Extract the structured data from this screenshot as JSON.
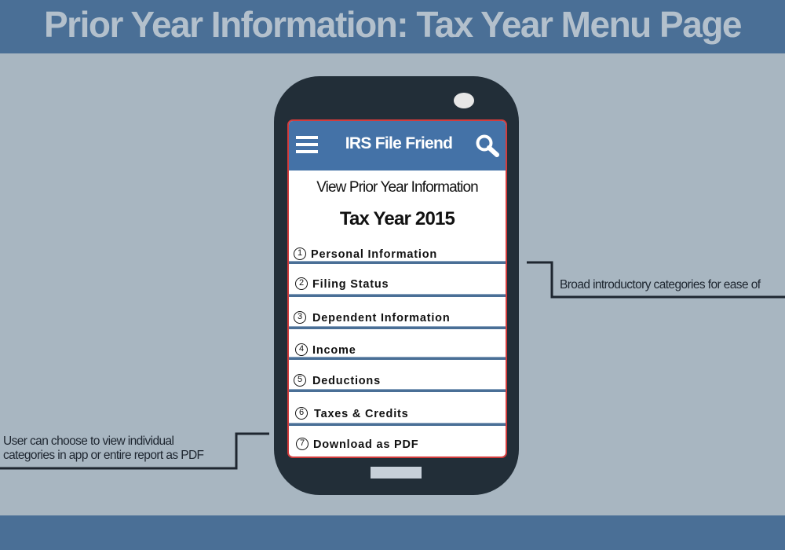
{
  "slide": {
    "title": "Prior Year Information: Tax Year Menu Page"
  },
  "app": {
    "title": "IRS File Friend",
    "subtitle": "View Prior Year Information",
    "tax_year_label": "Tax Year 2015",
    "menu_items": [
      {
        "number": "1",
        "label": "Personal Information"
      },
      {
        "number": "2",
        "label": "Filing Status"
      },
      {
        "number": "3",
        "label": "Dependent Information"
      },
      {
        "number": "4",
        "label": "Income"
      },
      {
        "number": "5",
        "label": "Deductions"
      },
      {
        "number": "6",
        "label": "Taxes & Credits"
      },
      {
        "number": "7",
        "label": "Download as PDF"
      }
    ]
  },
  "annotations": {
    "right_callout": "Broad introductory categories for ease of",
    "left_callout_line1": "User can choose to view individual",
    "left_callout_line2": "categories in app or entire report as PDF"
  },
  "icons": {
    "menu": "hamburger-menu-icon",
    "search": "magnifying-glass-icon",
    "speaker": "phone-speaker",
    "home": "phone-home-button"
  },
  "colors": {
    "banner": "#4a6f96",
    "background": "#a8b6c1",
    "phone_body": "#222e38",
    "app_header": "#4472a7",
    "screen_border": "#d23c3c"
  }
}
